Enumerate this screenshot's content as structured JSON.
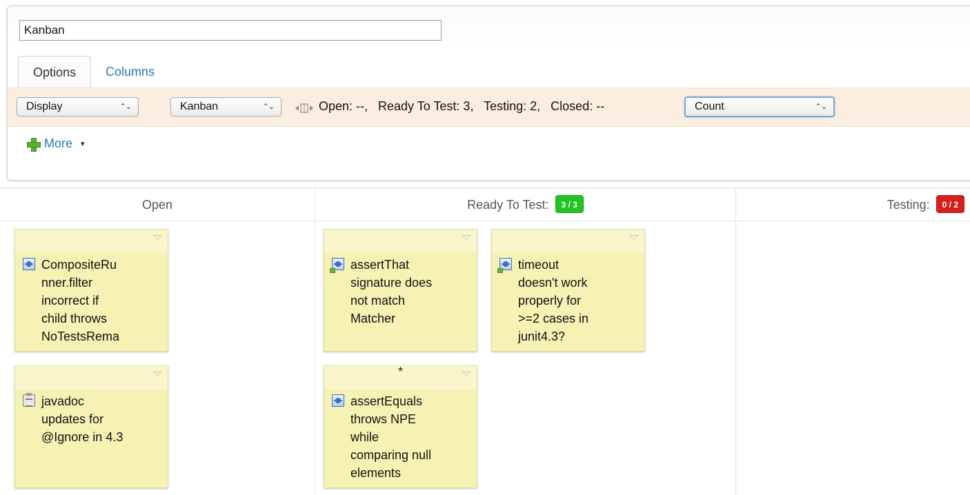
{
  "header": {
    "board_title": "Kanban",
    "tabs": [
      {
        "label": "Options",
        "active": true
      },
      {
        "label": "Columns",
        "active": false
      }
    ]
  },
  "options_bar": {
    "display_select": "Display",
    "mode_select": "Kanban",
    "swimlane_icon": "swimlane-icon",
    "summary": "Open: --,   Ready To Test: 3,   Testing: 2,   Closed: --",
    "aggregate_select": "Count",
    "select_arrows": "⌃⌄"
  },
  "more": {
    "label": "More",
    "icon": "plus-icon",
    "caret": "▾"
  },
  "colors": {
    "accent": "#2b7ab0",
    "card": "#f6f2b4",
    "badge_ok": "#22c322",
    "badge_over": "#d62020",
    "options_bar": "#fbeee0"
  },
  "columns": [
    {
      "title": "Open",
      "badge": null,
      "cards": [
        {
          "icon": "defect-icon",
          "star": "",
          "text": "CompositeRu\nnner.filter\nincorrect if\nchild throws\nNoTestsRema"
        },
        {
          "icon": "task-icon",
          "star": "",
          "text": "javadoc\nupdates for\n@Ignore in 4.3"
        }
      ]
    },
    {
      "title": "Ready To Test:",
      "badge": {
        "text": "3 / 3",
        "status": "green"
      },
      "cards": [
        {
          "icon": "defect-icon",
          "star": "",
          "text": "assertThat\nsignature does\nnot match\nMatcher"
        },
        {
          "icon": "defect-icon",
          "star": "",
          "text": "timeout\ndoesn't work\nproperly for\n>=2 cases in\njunit4.3?"
        },
        {
          "icon": "defect-icon",
          "star": "*",
          "text": "assertEquals\nthrows NPE\nwhile\ncomparing null\nelements"
        }
      ]
    },
    {
      "title": "Testing:",
      "badge": {
        "text": "0 / 2",
        "status": "red"
      },
      "cards": []
    }
  ]
}
